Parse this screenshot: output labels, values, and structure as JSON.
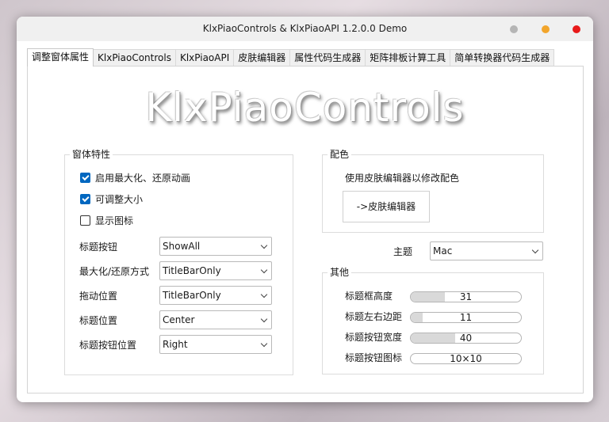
{
  "window": {
    "title": "KlxPiaoControls & KlxPiaoAPI 1.2.0.0 Demo",
    "button_colors": [
      "#b5b5b5",
      "#f2a52b",
      "#e81a1a"
    ]
  },
  "tabs": [
    {
      "label": "调整窗体属性",
      "active": true
    },
    {
      "label": "KlxPiaoControls",
      "active": false
    },
    {
      "label": "KlxPiaoAPI",
      "active": false
    },
    {
      "label": "皮肤编辑器",
      "active": false
    },
    {
      "label": "属性代码生成器",
      "active": false
    },
    {
      "label": "矩阵排板计算工具",
      "active": false
    },
    {
      "label": "简单转换器代码生成器",
      "active": false
    }
  ],
  "logo_text": "KlxPiaoControls",
  "window_features": {
    "title": "窗体特性",
    "checkboxes": [
      {
        "label": "启用最大化、还原动画",
        "checked": true
      },
      {
        "label": "可调整大小",
        "checked": true
      },
      {
        "label": "显示图标",
        "checked": false
      }
    ],
    "fields": [
      {
        "label": "标题按钮",
        "value": "ShowAll"
      },
      {
        "label": "最大化/还原方式",
        "value": "TitleBarOnly"
      },
      {
        "label": "拖动位置",
        "value": "TitleBarOnly"
      },
      {
        "label": "标题位置",
        "value": "Center"
      },
      {
        "label": "标题按钮位置",
        "value": "Right"
      }
    ]
  },
  "color_scheme": {
    "title": "配色",
    "hint": "使用皮肤编辑器以修改配色",
    "button_label": "->皮肤编辑器"
  },
  "theme": {
    "label": "主题",
    "value": "Mac"
  },
  "other": {
    "title": "其他",
    "bars": [
      {
        "label": "标题框高度",
        "value": "31",
        "fill": 0.31
      },
      {
        "label": "标题左右边距",
        "value": "11",
        "fill": 0.11
      },
      {
        "label": "标题按钮宽度",
        "value": "40",
        "fill": 0.4
      },
      {
        "label": "标题按钮图标",
        "value": "10×10",
        "fill": 0.0
      }
    ]
  },
  "accent_color": "#0067c0"
}
